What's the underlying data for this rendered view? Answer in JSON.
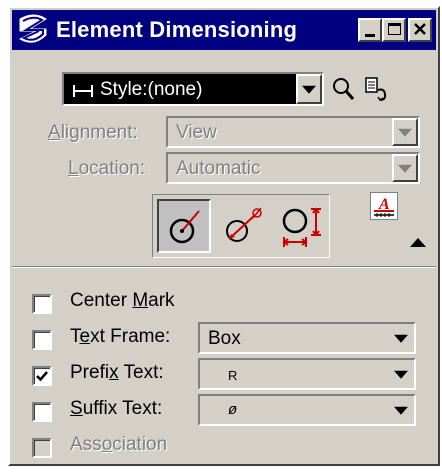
{
  "window": {
    "title": "Element Dimensioning",
    "controls": [
      "minimize",
      "maximize",
      "close"
    ]
  },
  "style": {
    "value": "Style:(none)"
  },
  "alignment": {
    "label_pre": "",
    "label_ul": "A",
    "label_post": "lignment:",
    "value": "View",
    "enabled": false
  },
  "location": {
    "label_pre": "",
    "label_ul": "L",
    "label_post": "ocation:",
    "value": "Automatic",
    "enabled": false
  },
  "tools": [
    {
      "name": "linear-radius-tool",
      "selected": true
    },
    {
      "name": "diameter-tool",
      "selected": false
    },
    {
      "name": "diameter-extended-tool",
      "selected": false
    }
  ],
  "options": {
    "center_mark": {
      "label_pre": "Center ",
      "label_ul": "M",
      "label_post": "ark",
      "checked": false,
      "enabled": true
    },
    "text_frame": {
      "label_pre": "T",
      "label_ul": "e",
      "label_post": "xt Frame:",
      "checked": false,
      "enabled": true,
      "value": "Box"
    },
    "prefix_text": {
      "label_pre": "Prefi",
      "label_ul": "x",
      "label_post": " Text:",
      "checked": true,
      "enabled": true,
      "value": "R"
    },
    "suffix_text": {
      "label_pre": "",
      "label_ul": "S",
      "label_post": "uffix Text:",
      "checked": false,
      "enabled": true,
      "value": "ø"
    },
    "association": {
      "label_pre": "Ass",
      "label_ul": "o",
      "label_post": "ciation",
      "checked": false,
      "enabled": false
    }
  },
  "colors": {
    "titlebar": "#000080",
    "face": "#d4d0c8",
    "disabled_text": "#808080",
    "accent_red": "#cc0000"
  }
}
